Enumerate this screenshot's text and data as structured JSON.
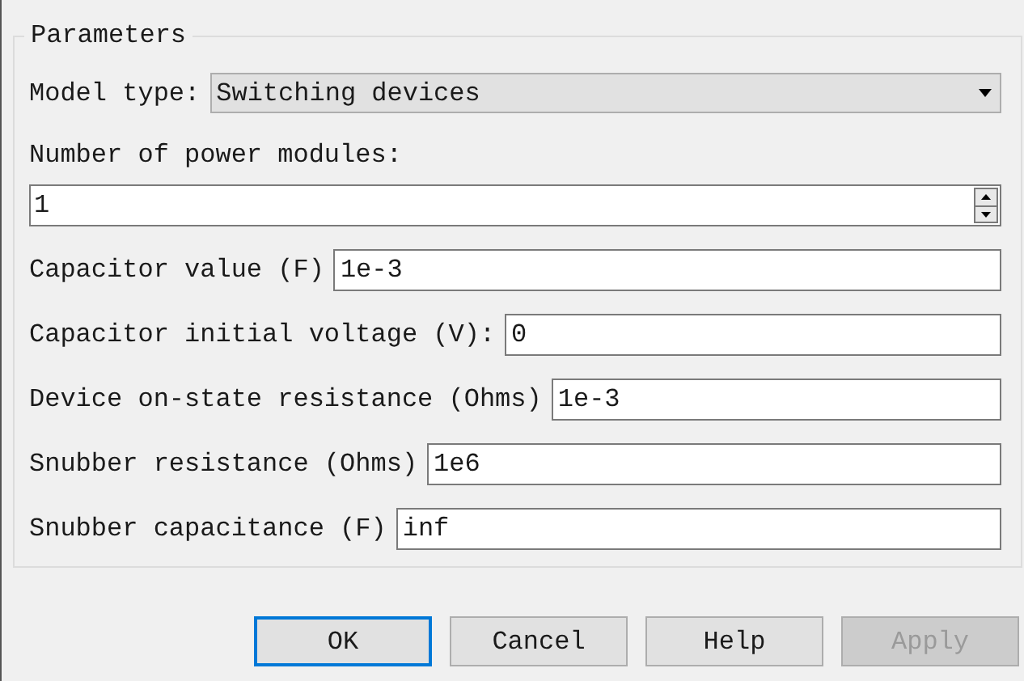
{
  "group": {
    "title": "Parameters"
  },
  "fields": [
    {
      "kind": "dropdown",
      "label": "Model type:",
      "value": "Switching devices"
    },
    {
      "kind": "spin",
      "label": "Number of power modules:",
      "value": "1"
    },
    {
      "kind": "text",
      "label": "Capacitor value (F)",
      "value": "1e-3"
    },
    {
      "kind": "text",
      "label": "Capacitor initial voltage (V):",
      "value": "0"
    },
    {
      "kind": "text",
      "label": "Device on-state resistance (Ohms)",
      "value": "1e-3"
    },
    {
      "kind": "text",
      "label": "Snubber resistance (Ohms)",
      "value": "1e6"
    },
    {
      "kind": "text",
      "label": "Snubber capacitance (F)",
      "value": "inf"
    }
  ],
  "buttons": [
    {
      "label": "OK",
      "default": true,
      "disabled": false
    },
    {
      "label": "Cancel",
      "default": false,
      "disabled": false
    },
    {
      "label": "Help",
      "default": false,
      "disabled": false
    },
    {
      "label": "Apply",
      "default": false,
      "disabled": true
    }
  ]
}
